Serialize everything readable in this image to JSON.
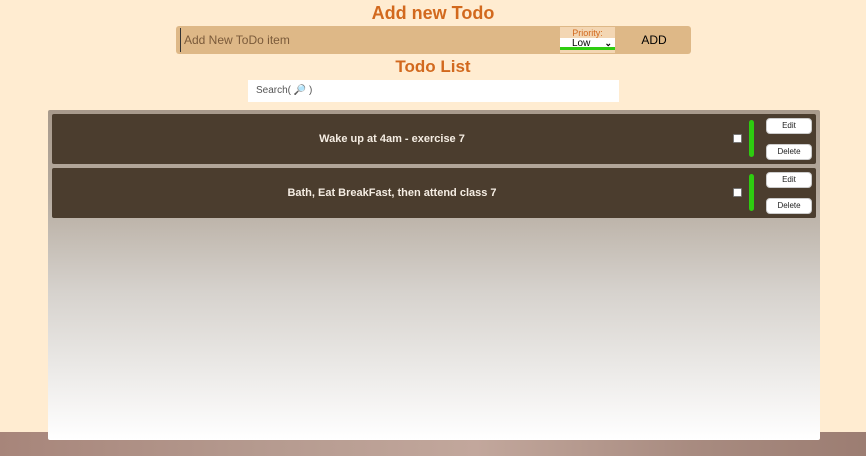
{
  "add_section": {
    "title": "Add new Todo",
    "input_placeholder": "Add New ToDo item",
    "priority_label": "Priority:",
    "priority_value": "Low",
    "priority_color": "#2ecc10",
    "add_button": "ADD"
  },
  "list_section": {
    "title": "Todo List",
    "search_label": "Search( 🔎 )"
  },
  "todos": [
    {
      "text": "Wake up at 4am - exercise 7",
      "checked": false,
      "priority_color": "#2ecc10",
      "edit_label": "Edit",
      "delete_label": "Delete"
    },
    {
      "text": "Bath, Eat BreakFast, then attend class 7",
      "checked": false,
      "priority_color": "#2ecc10",
      "edit_label": "Edit",
      "delete_label": "Delete"
    }
  ],
  "colors": {
    "background": "#ffecd1",
    "accent": "#d2691e",
    "bar": "#deb887",
    "todo_bg": "#4b3d2e"
  }
}
